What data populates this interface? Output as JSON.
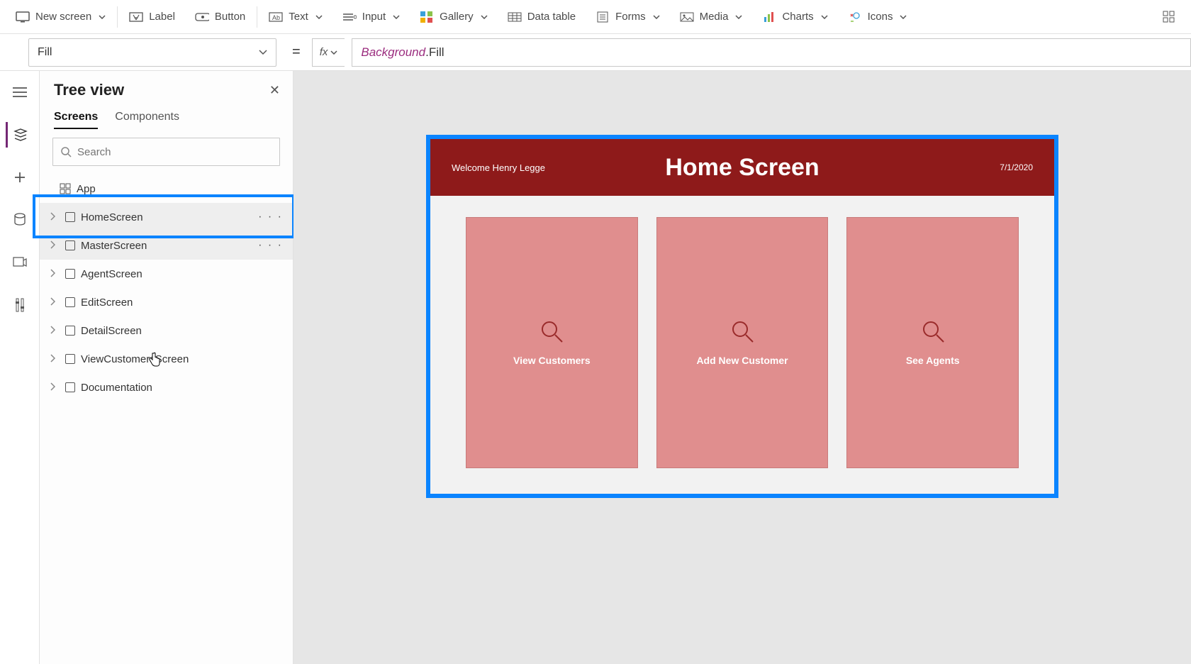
{
  "ribbon": {
    "new_screen": "New screen",
    "label": "Label",
    "button": "Button",
    "text": "Text",
    "input": "Input",
    "gallery": "Gallery",
    "data_table": "Data table",
    "forms": "Forms",
    "media": "Media",
    "charts": "Charts",
    "icons": "Icons"
  },
  "formula": {
    "property": "Fill",
    "equals": "=",
    "fx": "fx",
    "ref": "Background",
    "prop": ".Fill"
  },
  "tree": {
    "title": "Tree view",
    "tab_screens": "Screens",
    "tab_components": "Components",
    "search_placeholder": "Search",
    "items": [
      {
        "label": "App",
        "type": "app"
      },
      {
        "label": "HomeScreen",
        "type": "screen",
        "selected": true
      },
      {
        "label": "MasterScreen",
        "type": "screen",
        "hover": true
      },
      {
        "label": "AgentScreen",
        "type": "screen"
      },
      {
        "label": "EditScreen",
        "type": "screen"
      },
      {
        "label": "DetailScreen",
        "type": "screen"
      },
      {
        "label": "ViewCustomersScreen",
        "type": "screen"
      },
      {
        "label": "Documentation",
        "type": "screen"
      }
    ]
  },
  "screen": {
    "welcome": "Welcome Henry Legge",
    "title": "Home Screen",
    "date": "7/1/2020",
    "cards": [
      {
        "label": "View Customers"
      },
      {
        "label": "Add New Customer"
      },
      {
        "label": "See Agents"
      }
    ]
  }
}
